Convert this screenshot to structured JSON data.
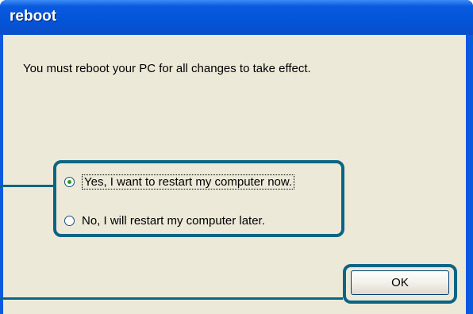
{
  "window": {
    "title": "reboot"
  },
  "dialog": {
    "message": "You must reboot your PC for all changes to take effect.",
    "options": [
      {
        "label": "Yes, I want to restart my computer now.",
        "selected": true
      },
      {
        "label": "No, I will restart my computer later.",
        "selected": false
      }
    ],
    "ok_label": "OK"
  },
  "colors": {
    "titlebar": "#0a5ae0",
    "dialog_bg": "#ece9d8",
    "callout": "#0b6585",
    "radio_selected": "#21a121"
  }
}
